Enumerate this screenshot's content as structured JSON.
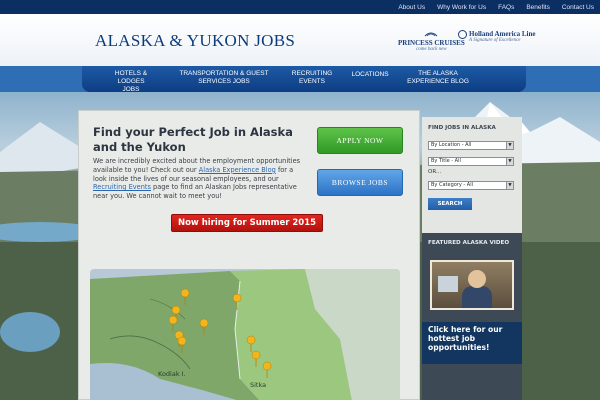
{
  "topbar": {
    "links": [
      "About Us",
      "Why Work for Us",
      "FAQs",
      "Benefits",
      "Contact Us"
    ]
  },
  "header": {
    "logo_text": "ALASKA & YUKON JOBS",
    "partners": {
      "princess": {
        "title": "PRINCESS CRUISES",
        "subtitle": "come back new"
      },
      "hal": {
        "title": "Holland America Line",
        "subtitle": "A Signature of Excellence"
      }
    }
  },
  "nav": {
    "items": [
      {
        "line1": "HOTELS &",
        "line2": "LODGES JOBS"
      },
      {
        "line1": "TRANSPORTATION & GUEST",
        "line2": "SERVICES JOBS"
      },
      {
        "line1": "RECRUITING",
        "line2": "EVENTS"
      },
      {
        "line1": "LOCATIONS",
        "line2": ""
      },
      {
        "line1": "THE ALASKA",
        "line2": "EXPERIENCE BLOG"
      }
    ]
  },
  "main": {
    "headline": "Find your Perfect Job in Alaska and the Yukon",
    "intro": {
      "part1": "We are incredibly excited about the employment opportunities available to you! Check out our ",
      "link1": "Alaska Experience Blog",
      "part2": " for a look inside the lives of our seasonal employees, and our ",
      "link2": "Recruiting Events",
      "part3": " page to find an Alaskan Jobs representative near you. We cannot wait to meet you!"
    },
    "apply_label": "APPLY NOW",
    "browse_label": "BROWSE JOBS",
    "hiring_label": "Now hiring for Summer 2015",
    "map_labels": {
      "kodiak": "Kodiak I.",
      "sitka": "Sitka"
    }
  },
  "sidebar": {
    "find_title": "FIND JOBS IN ALASKA",
    "location_select": "By Location - All",
    "title_select": "By Title - All",
    "or_text": "OR...",
    "category_select": "By Category - All",
    "search_label": "SEARCH",
    "video_title": "FEATURED ALASKA VIDEO",
    "cta_text": "Click here for our hottest job opportunities!"
  },
  "colors": {
    "topbar": "#0b2e63",
    "nav": "#1d5aa5",
    "apply": "#3faa30",
    "browse": "#3b85d4",
    "hiring": "#c8160f",
    "sidebar_cta": "#12365f"
  }
}
